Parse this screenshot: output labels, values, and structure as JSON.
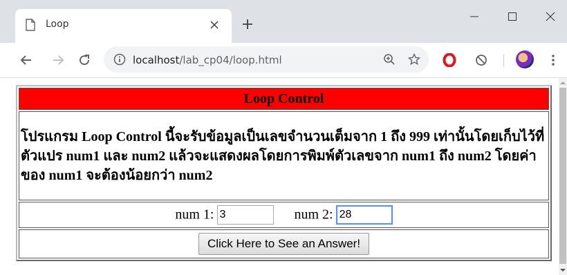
{
  "browser": {
    "tab_title": "Loop",
    "url_host": "localhost",
    "url_path": "/lab_cp04/loop.html"
  },
  "page": {
    "heading": "Loop Control",
    "description": "โปรแกรม Loop Control นี้จะรับข้อมูลเป็นเลขจำนวนเต็มจาก 1 ถึง 999 เท่านั้นโดยเก็บไว้ที่ตัวแปร num1 และ num2 แล้วจะแสดงผลโดยการพิมพ์ตัวเลขจาก num1 ถึง num2 โดยค่าของ num1 จะต้องน้อยกว่า num2",
    "num1_label": "num 1:",
    "num1_value": "3",
    "num2_label": "num 2:",
    "num2_value": "28",
    "button_label": "Click Here to See an Answer!"
  },
  "colors": {
    "heading_bg": "#ff0000",
    "focus_border": "#4d90fe"
  }
}
